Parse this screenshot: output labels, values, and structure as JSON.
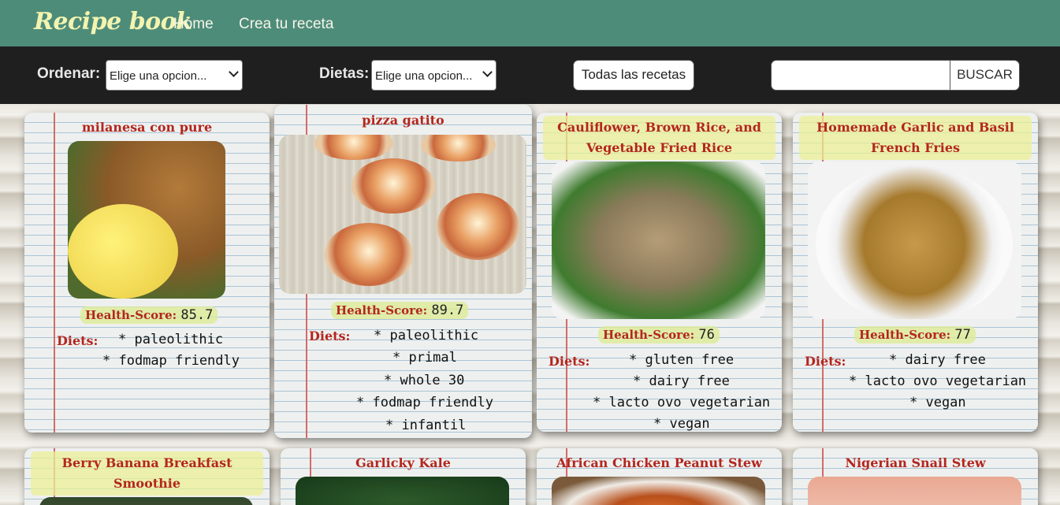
{
  "navbar": {
    "brand": "Recipe book",
    "links": [
      "Home",
      "Crea tu receta"
    ]
  },
  "toolbar": {
    "order_label": "Ordenar:",
    "order_select": "Elige una opcion...",
    "diets_label": "Dietas:",
    "diets_select": "Elige una opcion...",
    "all_recipes_button": "Todas las recetas",
    "search_value": "",
    "search_button": "BUSCAR"
  },
  "labels": {
    "health_score": "Health-Score:",
    "diets": "Diets:"
  },
  "recipes": [
    {
      "title": "milanesa con pure",
      "health_score": "85.7",
      "diets": [
        "* paleolithic",
        "* fodmap friendly"
      ]
    },
    {
      "title": "pizza gatito",
      "health_score": "89.7",
      "diets": [
        "* paleolithic",
        "* primal",
        "* whole 30",
        "* fodmap friendly",
        "* infantil"
      ]
    },
    {
      "title": "Cauliflower, Brown Rice, and Vegetable Fried Rice",
      "title_lines": [
        "Cauliflower, Brown Rice, and",
        "Vegetable Fried Rice"
      ],
      "health_score": "76",
      "diets": [
        "* gluten free",
        "* dairy free",
        "* lacto ovo vegetarian",
        "* vegan"
      ]
    },
    {
      "title": "Homemade Garlic and Basil French Fries",
      "title_lines": [
        "Homemade Garlic and Basil",
        "French Fries"
      ],
      "health_score": "77",
      "diets": [
        "* dairy free",
        "* lacto ovo vegetarian",
        "* vegan"
      ]
    },
    {
      "title": "Berry Banana Breakfast Smoothie",
      "title_lines": [
        "Berry Banana Breakfast",
        "Smoothie"
      ]
    },
    {
      "title": "Garlicky Kale"
    },
    {
      "title": "African Chicken Peanut Stew"
    },
    {
      "title": "Nigerian Snail Stew"
    }
  ],
  "colors": {
    "navbar": "#4e8c7a",
    "toolbar": "#1f1f1f",
    "brand": "#f3f4b0",
    "title_red": "#b3261e"
  }
}
